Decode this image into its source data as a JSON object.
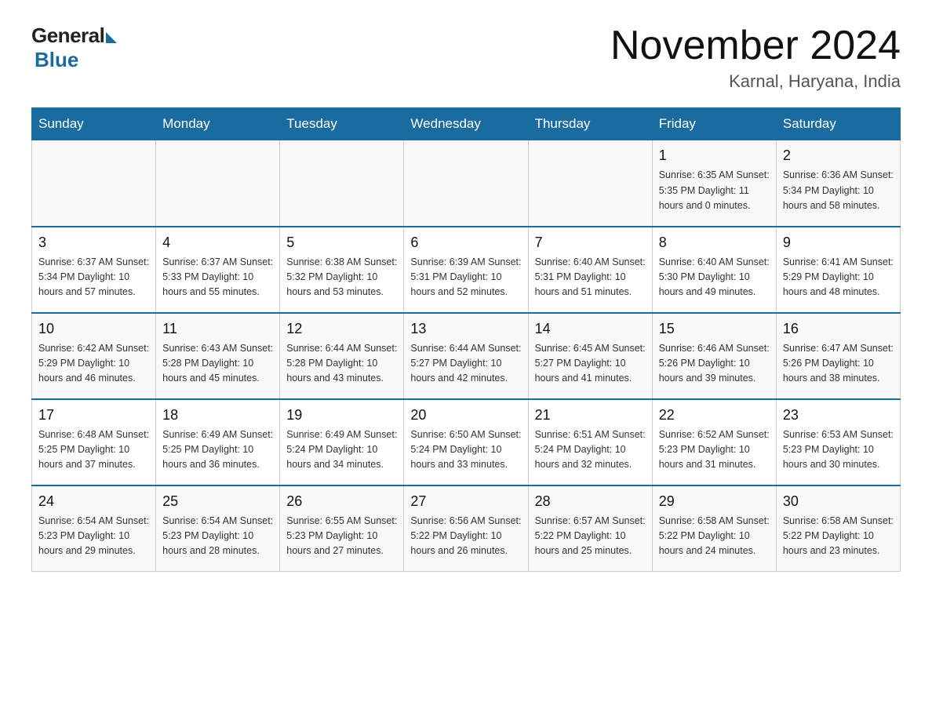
{
  "logo": {
    "general": "General",
    "blue": "Blue"
  },
  "title": "November 2024",
  "subtitle": "Karnal, Haryana, India",
  "weekdays": [
    "Sunday",
    "Monday",
    "Tuesday",
    "Wednesday",
    "Thursday",
    "Friday",
    "Saturday"
  ],
  "weeks": [
    [
      {
        "day": "",
        "info": ""
      },
      {
        "day": "",
        "info": ""
      },
      {
        "day": "",
        "info": ""
      },
      {
        "day": "",
        "info": ""
      },
      {
        "day": "",
        "info": ""
      },
      {
        "day": "1",
        "info": "Sunrise: 6:35 AM\nSunset: 5:35 PM\nDaylight: 11 hours\nand 0 minutes."
      },
      {
        "day": "2",
        "info": "Sunrise: 6:36 AM\nSunset: 5:34 PM\nDaylight: 10 hours\nand 58 minutes."
      }
    ],
    [
      {
        "day": "3",
        "info": "Sunrise: 6:37 AM\nSunset: 5:34 PM\nDaylight: 10 hours\nand 57 minutes."
      },
      {
        "day": "4",
        "info": "Sunrise: 6:37 AM\nSunset: 5:33 PM\nDaylight: 10 hours\nand 55 minutes."
      },
      {
        "day": "5",
        "info": "Sunrise: 6:38 AM\nSunset: 5:32 PM\nDaylight: 10 hours\nand 53 minutes."
      },
      {
        "day": "6",
        "info": "Sunrise: 6:39 AM\nSunset: 5:31 PM\nDaylight: 10 hours\nand 52 minutes."
      },
      {
        "day": "7",
        "info": "Sunrise: 6:40 AM\nSunset: 5:31 PM\nDaylight: 10 hours\nand 51 minutes."
      },
      {
        "day": "8",
        "info": "Sunrise: 6:40 AM\nSunset: 5:30 PM\nDaylight: 10 hours\nand 49 minutes."
      },
      {
        "day": "9",
        "info": "Sunrise: 6:41 AM\nSunset: 5:29 PM\nDaylight: 10 hours\nand 48 minutes."
      }
    ],
    [
      {
        "day": "10",
        "info": "Sunrise: 6:42 AM\nSunset: 5:29 PM\nDaylight: 10 hours\nand 46 minutes."
      },
      {
        "day": "11",
        "info": "Sunrise: 6:43 AM\nSunset: 5:28 PM\nDaylight: 10 hours\nand 45 minutes."
      },
      {
        "day": "12",
        "info": "Sunrise: 6:44 AM\nSunset: 5:28 PM\nDaylight: 10 hours\nand 43 minutes."
      },
      {
        "day": "13",
        "info": "Sunrise: 6:44 AM\nSunset: 5:27 PM\nDaylight: 10 hours\nand 42 minutes."
      },
      {
        "day": "14",
        "info": "Sunrise: 6:45 AM\nSunset: 5:27 PM\nDaylight: 10 hours\nand 41 minutes."
      },
      {
        "day": "15",
        "info": "Sunrise: 6:46 AM\nSunset: 5:26 PM\nDaylight: 10 hours\nand 39 minutes."
      },
      {
        "day": "16",
        "info": "Sunrise: 6:47 AM\nSunset: 5:26 PM\nDaylight: 10 hours\nand 38 minutes."
      }
    ],
    [
      {
        "day": "17",
        "info": "Sunrise: 6:48 AM\nSunset: 5:25 PM\nDaylight: 10 hours\nand 37 minutes."
      },
      {
        "day": "18",
        "info": "Sunrise: 6:49 AM\nSunset: 5:25 PM\nDaylight: 10 hours\nand 36 minutes."
      },
      {
        "day": "19",
        "info": "Sunrise: 6:49 AM\nSunset: 5:24 PM\nDaylight: 10 hours\nand 34 minutes."
      },
      {
        "day": "20",
        "info": "Sunrise: 6:50 AM\nSunset: 5:24 PM\nDaylight: 10 hours\nand 33 minutes."
      },
      {
        "day": "21",
        "info": "Sunrise: 6:51 AM\nSunset: 5:24 PM\nDaylight: 10 hours\nand 32 minutes."
      },
      {
        "day": "22",
        "info": "Sunrise: 6:52 AM\nSunset: 5:23 PM\nDaylight: 10 hours\nand 31 minutes."
      },
      {
        "day": "23",
        "info": "Sunrise: 6:53 AM\nSunset: 5:23 PM\nDaylight: 10 hours\nand 30 minutes."
      }
    ],
    [
      {
        "day": "24",
        "info": "Sunrise: 6:54 AM\nSunset: 5:23 PM\nDaylight: 10 hours\nand 29 minutes."
      },
      {
        "day": "25",
        "info": "Sunrise: 6:54 AM\nSunset: 5:23 PM\nDaylight: 10 hours\nand 28 minutes."
      },
      {
        "day": "26",
        "info": "Sunrise: 6:55 AM\nSunset: 5:23 PM\nDaylight: 10 hours\nand 27 minutes."
      },
      {
        "day": "27",
        "info": "Sunrise: 6:56 AM\nSunset: 5:22 PM\nDaylight: 10 hours\nand 26 minutes."
      },
      {
        "day": "28",
        "info": "Sunrise: 6:57 AM\nSunset: 5:22 PM\nDaylight: 10 hours\nand 25 minutes."
      },
      {
        "day": "29",
        "info": "Sunrise: 6:58 AM\nSunset: 5:22 PM\nDaylight: 10 hours\nand 24 minutes."
      },
      {
        "day": "30",
        "info": "Sunrise: 6:58 AM\nSunset: 5:22 PM\nDaylight: 10 hours\nand 23 minutes."
      }
    ]
  ]
}
